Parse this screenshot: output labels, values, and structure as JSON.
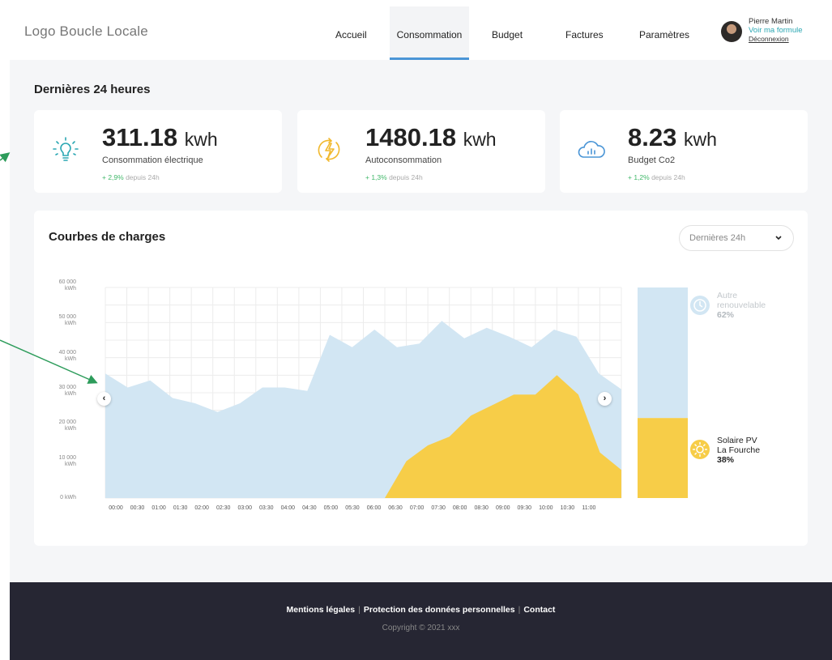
{
  "header": {
    "logo": "Logo Boucle Locale",
    "nav": [
      "Accueil",
      "Consommation",
      "Budget",
      "Factures",
      "Paramètres"
    ],
    "active_nav": "Consommation",
    "user": {
      "name": "Pierre Martin",
      "formula_link": "Voir ma formule",
      "logout": "Déconnexion"
    }
  },
  "section_title": "Dernières 24 heures",
  "stats": [
    {
      "value": "311.18",
      "unit": "kwh",
      "label": "Consommation électrique",
      "change": "+ 2,9%",
      "since": "depuis 24h",
      "icon": "lightbulb-icon"
    },
    {
      "value": "1480.18",
      "unit": "kwh",
      "label": "Autoconsommation",
      "change": "+ 1,3%",
      "since": "depuis 24h",
      "icon": "lightning-icon"
    },
    {
      "value": "8.23",
      "unit": "kwh",
      "label": "Budget Co2",
      "change": "+ 1,2%",
      "since": "depuis 24h",
      "icon": "cloud-chart-icon"
    }
  ],
  "chart": {
    "title": "Courbes de charges",
    "period_select": "Dernières 24h"
  },
  "chart_data": {
    "type": "area",
    "x": [
      "00:00",
      "00:30",
      "01:00",
      "01:30",
      "02:00",
      "02:30",
      "03:00",
      "03:30",
      "04:00",
      "04:30",
      "05:00",
      "05:30",
      "06:00",
      "06:30",
      "07:00",
      "07:30",
      "08:00",
      "08:30",
      "09:00",
      "09:30",
      "10:00",
      "10:30",
      "11:00"
    ],
    "y_ticks": [
      "0 kWh",
      "10 000 kWh",
      "20 000 kWh",
      "30 000 kWh",
      "40 000 kWh",
      "50 000 kWh",
      "60 000 kWh"
    ],
    "ylim": [
      0,
      60000
    ],
    "grid": true,
    "series": [
      {
        "name": "Autre renouvelable",
        "color": "#d2e6f3",
        "values": [
          35500,
          31500,
          33500,
          28500,
          27000,
          24500,
          27000,
          31500,
          31500,
          30500,
          46500,
          43000,
          48000,
          43000,
          44000,
          50500,
          45500,
          48500,
          46000,
          43000,
          48000,
          46000,
          35500,
          31000
        ]
      },
      {
        "name": "Solaire PV La Fourche",
        "color": "#f7cd48",
        "values": [
          0,
          0,
          0,
          0,
          0,
          0,
          0,
          0,
          0,
          0,
          0,
          0,
          0,
          0,
          10500,
          15000,
          17500,
          23500,
          26500,
          29500,
          29500,
          35000,
          29500,
          13000,
          8000
        ]
      }
    ],
    "mix": [
      {
        "name_lines": [
          "Autre",
          "renouvelable"
        ],
        "percent": "62%",
        "color": "#d2e6f3"
      },
      {
        "name_lines": [
          "Solaire PV",
          "La Fourche"
        ],
        "percent": "38%",
        "color": "#f7cd48"
      }
    ]
  },
  "footer": {
    "links": [
      "Mentions légales",
      "Protection des données personnelles",
      "Contact"
    ],
    "copyright": "Copyright © 2021 xxx"
  },
  "colors": {
    "accent_blue": "#4a95d6",
    "teal": "#2ba7b3",
    "green_change": "#41b86a",
    "footer_bg": "#262633",
    "arrow": "#2d9c5b"
  }
}
